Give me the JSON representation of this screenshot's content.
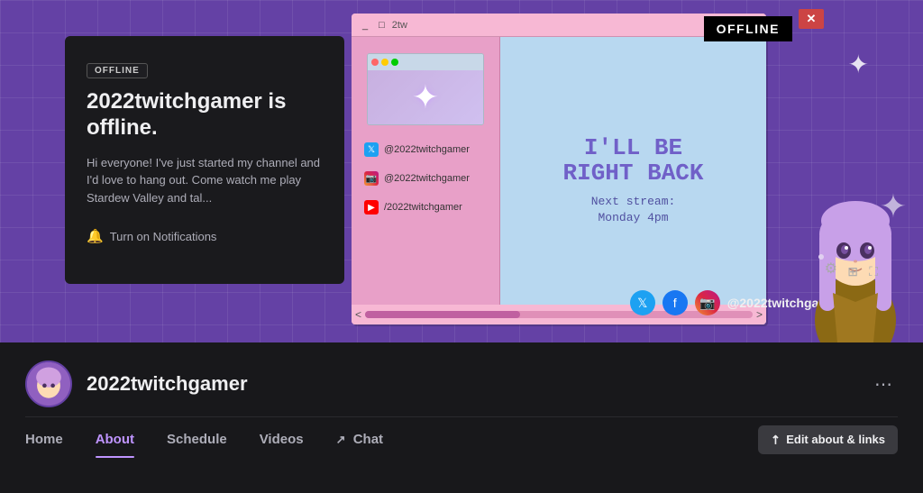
{
  "banner": {
    "offline_badge": "OFFLINE",
    "big_offline": "OFFLINE",
    "title": "2022twitchgamer is offline.",
    "description": "Hi everyone! I've just started my channel and I'd love to hang out. Come watch me play Stardew Valley and tal...",
    "notify_label": "Turn on Notifications",
    "social_handle": "@2022twitchgamer",
    "retro": {
      "title_text": "2tw",
      "ill_be_back": "I'LL BE\nRIGHT BACK",
      "next_stream": "Next stream:\nMonday 4pm",
      "social_links": [
        {
          "platform": "twitter",
          "handle": "@2022twitchgamer"
        },
        {
          "platform": "instagram",
          "handle": "@2022twitchgamer"
        },
        {
          "platform": "youtube",
          "handle": "/2022twitchgamer"
        }
      ],
      "scroll_left": "<",
      "scroll_right": ">"
    }
  },
  "profile": {
    "username": "2022twitchgamer",
    "more_icon": "⋯"
  },
  "nav": {
    "items": [
      {
        "label": "Home",
        "active": false
      },
      {
        "label": "About",
        "active": true
      },
      {
        "label": "Schedule",
        "active": false
      },
      {
        "label": "Videos",
        "active": false
      },
      {
        "label": "Chat",
        "active": false,
        "icon": "↗"
      }
    ],
    "edit_button": "Edit about & links",
    "edit_icon": "↗"
  }
}
